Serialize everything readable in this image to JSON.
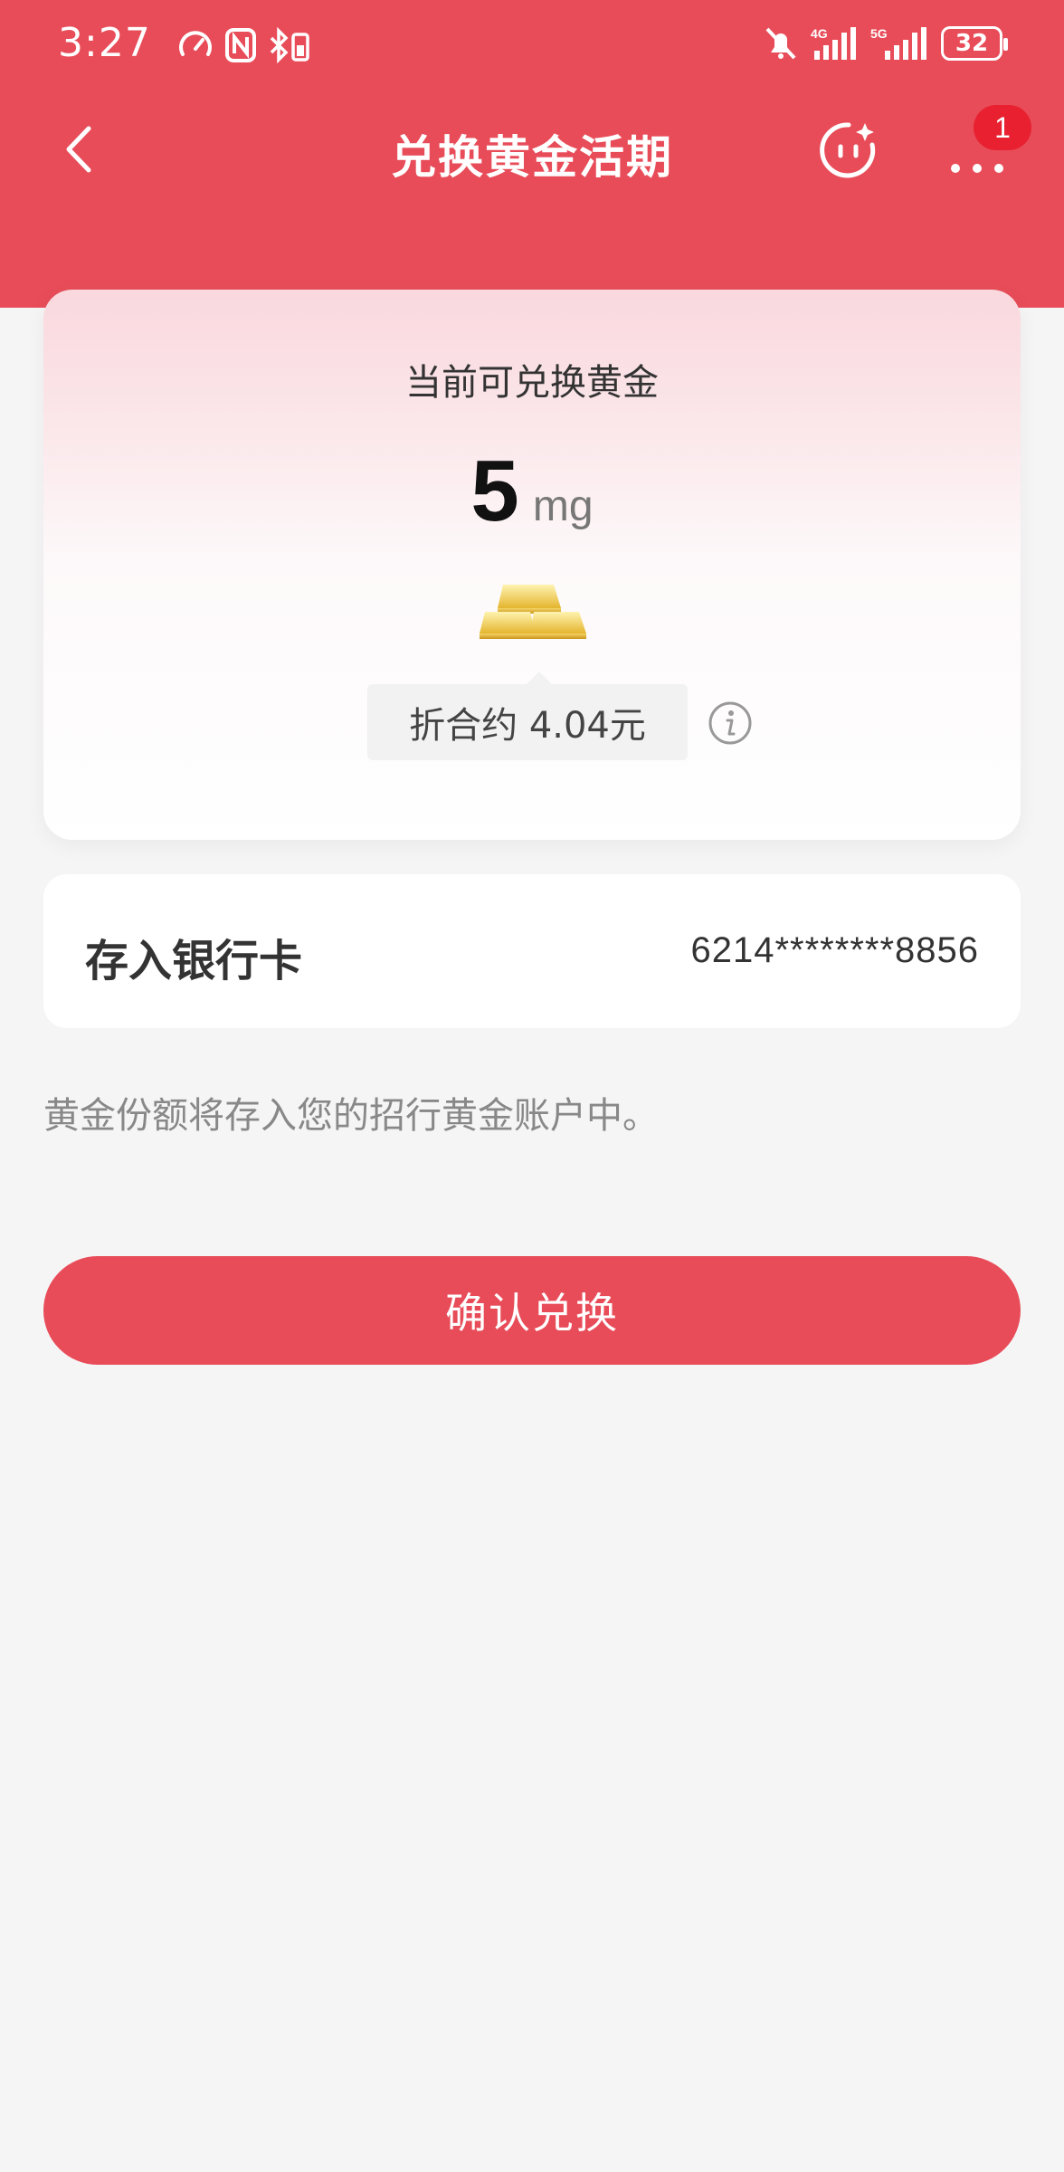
{
  "status_bar": {
    "time": "3:27",
    "network_1": "4G",
    "network_2": "5G",
    "battery": "32"
  },
  "nav": {
    "title": "兑换黄金活期",
    "badge_count": "1"
  },
  "gold_card": {
    "title": "当前可兑换黄金",
    "amount_value": "5",
    "amount_unit": "mg",
    "equivalent_text": "折合约 4.04元"
  },
  "bank_row": {
    "label": "存入银行卡",
    "card_number": "6214********8856"
  },
  "note": "黄金份额将存入您的招行黄金账户中。",
  "confirm_button": "确认兑换",
  "colors": {
    "brand_red": "#e84c59",
    "background": "#f6f5f6",
    "badge_red": "#e8202f"
  }
}
